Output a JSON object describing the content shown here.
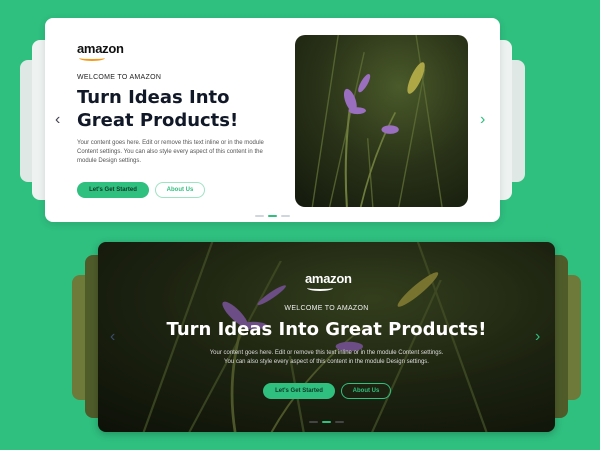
{
  "colors": {
    "background": "#2fbf7f",
    "accent": "#2fbf7f",
    "heading": "#111827"
  },
  "top_slider": {
    "logo": "amazon",
    "eyebrow": "WELCOME TO AMAZON",
    "title_line1": "Turn Ideas Into",
    "title_line2": "Great Products!",
    "body": "Your content goes here. Edit or remove this text inline or in the module Content settings. You can also style every aspect of this content in the module Design settings.",
    "primary_button": "Let's Get Started",
    "secondary_button": "About Us",
    "prev_icon": "chevron-left-icon",
    "next_icon": "chevron-right-icon",
    "active_slide": 2,
    "slide_count": 3
  },
  "bottom_slider": {
    "logo": "amazon",
    "eyebrow": "WELCOME TO AMAZON",
    "title": "Turn Ideas Into Great Products!",
    "body_line1": "Your content goes here. Edit or remove this text inline or in the module Content settings.",
    "body_line2": "You can also style every aspect of this content in the module Design settings.",
    "primary_button": "Let's Get Started",
    "secondary_button": "About Us",
    "prev_icon": "chevron-left-icon",
    "next_icon": "chevron-right-icon",
    "active_slide": 2,
    "slide_count": 3
  }
}
